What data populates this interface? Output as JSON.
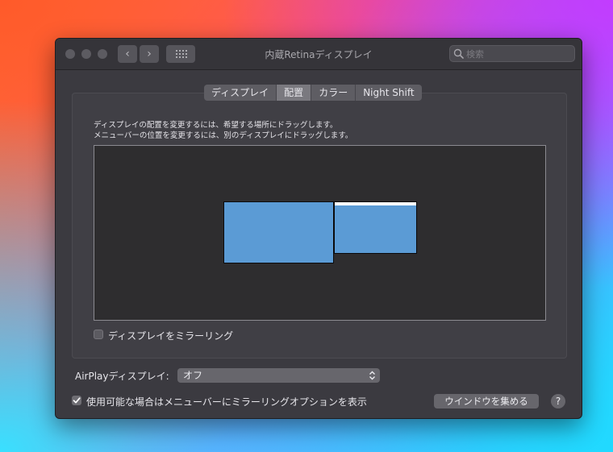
{
  "window": {
    "title": "内蔵Retinaディスプレイ",
    "nav_back_icon": "‹",
    "nav_forward_icon": "›"
  },
  "search": {
    "placeholder": "検索"
  },
  "tabs": [
    {
      "label": "ディスプレイ",
      "active": false
    },
    {
      "label": "配置",
      "active": true
    },
    {
      "label": "カラー",
      "active": false
    },
    {
      "label": "Night Shift",
      "active": false
    }
  ],
  "arrangement": {
    "description_line1": "ディスプレイの配置を変更するには、希望する場所にドラッグします。",
    "description_line2": "メニューバーの位置を変更するには、別のディスプレイにドラッグします。"
  },
  "mirror": {
    "label": "ディスプレイをミラーリング",
    "checked": false
  },
  "airplay": {
    "label": "AirPlayディスプレイ:",
    "value": "オフ"
  },
  "menu_option": {
    "label": "使用可能な場合はメニューバーにミラーリングオプションを表示",
    "checked": true
  },
  "gather_button": {
    "label": "ウインドウを集める"
  },
  "help": {
    "label": "?"
  },
  "colors": {
    "display_blue": "#5b9bd5",
    "checkbox_on": "#5e5d63",
    "window_bg": "#3b3a40"
  }
}
